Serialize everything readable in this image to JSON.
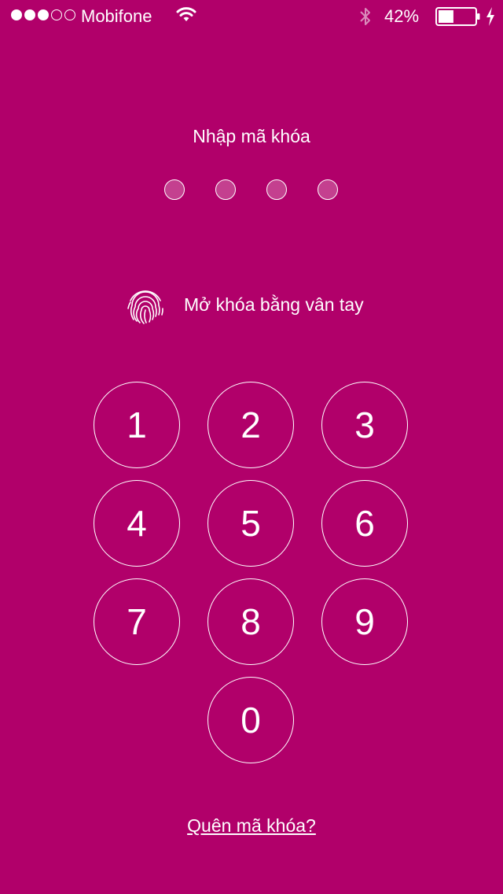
{
  "status_bar": {
    "signal_bars": 3,
    "signal_total": 5,
    "carrier": "Mobifone",
    "wifi_icon": "wifi-icon",
    "bluetooth_icon": "bluetooth-icon",
    "battery_percent": "42%",
    "battery_level": 0.42,
    "charging_icon": "charging-bolt-icon"
  },
  "lock": {
    "title": "Nhập mã khóa",
    "passcode_length": 4,
    "touch_id_label": "Mở khóa bằng vân tay",
    "forgot_link": "Quên mã khóa?"
  },
  "keypad": {
    "keys": [
      "1",
      "2",
      "3",
      "4",
      "5",
      "6",
      "7",
      "8",
      "9",
      "0"
    ]
  },
  "colors": {
    "background": "#b1006a",
    "foreground": "#ffffff"
  }
}
